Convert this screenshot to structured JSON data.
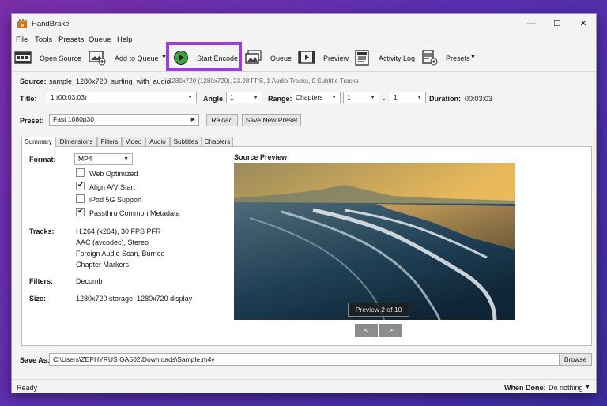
{
  "window": {
    "title": "HandBrake",
    "minimize": "—",
    "maximize": "☐",
    "close": "✕"
  },
  "menu": [
    "File",
    "Tools",
    "Presets",
    "Queue",
    "Help"
  ],
  "toolbar": {
    "open_source": "Open Source",
    "add_to_queue": "Add to Queue",
    "start_encode": "Start Encode",
    "queue": "Queue",
    "preview": "Preview",
    "activity_log": "Activity Log",
    "presets": "Presets"
  },
  "source": {
    "label": "Source:",
    "name": "sample_1280x720_surfing_with_audio",
    "info": "1280x720 (1280x720), 23.98 FPS, 1 Audio Tracks, 0 Subtitle Tracks"
  },
  "title_row": {
    "title_label": "Title:",
    "title_value": "1 (00:03:03)",
    "angle_label": "Angle:",
    "angle_value": "1",
    "range_label": "Range:",
    "range_value": "Chapters",
    "range_start": "1",
    "range_dash": "-",
    "range_end": "1",
    "duration_label": "Duration:",
    "duration_value": "00:03:03"
  },
  "preset": {
    "label": "Preset:",
    "value": "Fast 1080p30",
    "reload": "Reload",
    "save_new": "Save New Preset"
  },
  "tabs": [
    "Summary",
    "Dimensions",
    "Filters",
    "Video",
    "Audio",
    "Subtitles",
    "Chapters"
  ],
  "summary": {
    "format_label": "Format:",
    "format_value": "MP4",
    "options": [
      {
        "label": "Web Optimized",
        "checked": false
      },
      {
        "label": "Align A/V Start",
        "checked": true
      },
      {
        "label": "iPod 5G Support",
        "checked": false
      },
      {
        "label": "Passthru Common Metadata",
        "checked": true
      }
    ],
    "tracks_label": "Tracks:",
    "tracks": [
      "H.264 (x264), 30 FPS PFR",
      "AAC (avcodec), Stereo",
      "Foreign Audio Scan, Burned",
      "Chapter Markers"
    ],
    "filters_label": "Filters:",
    "filters_value": "Decomb",
    "size_label": "Size:",
    "size_value": "1280x720 storage, 1280x720 display",
    "preview_label": "Source Preview:",
    "preview_caption": "Preview 2 of 10",
    "prev_btn": "<",
    "next_btn": ">"
  },
  "save_as": {
    "label": "Save As:",
    "path": "C:\\Users\\ZEPHYRUS GA502\\Downloads\\Sample.m4v",
    "browse": "Browse"
  },
  "status": {
    "text": "Ready",
    "when_done_label": "When Done:",
    "when_done_value": "Do nothing"
  },
  "colors": {
    "highlight": "#9a3de0",
    "play_green": "#3aa43a"
  }
}
